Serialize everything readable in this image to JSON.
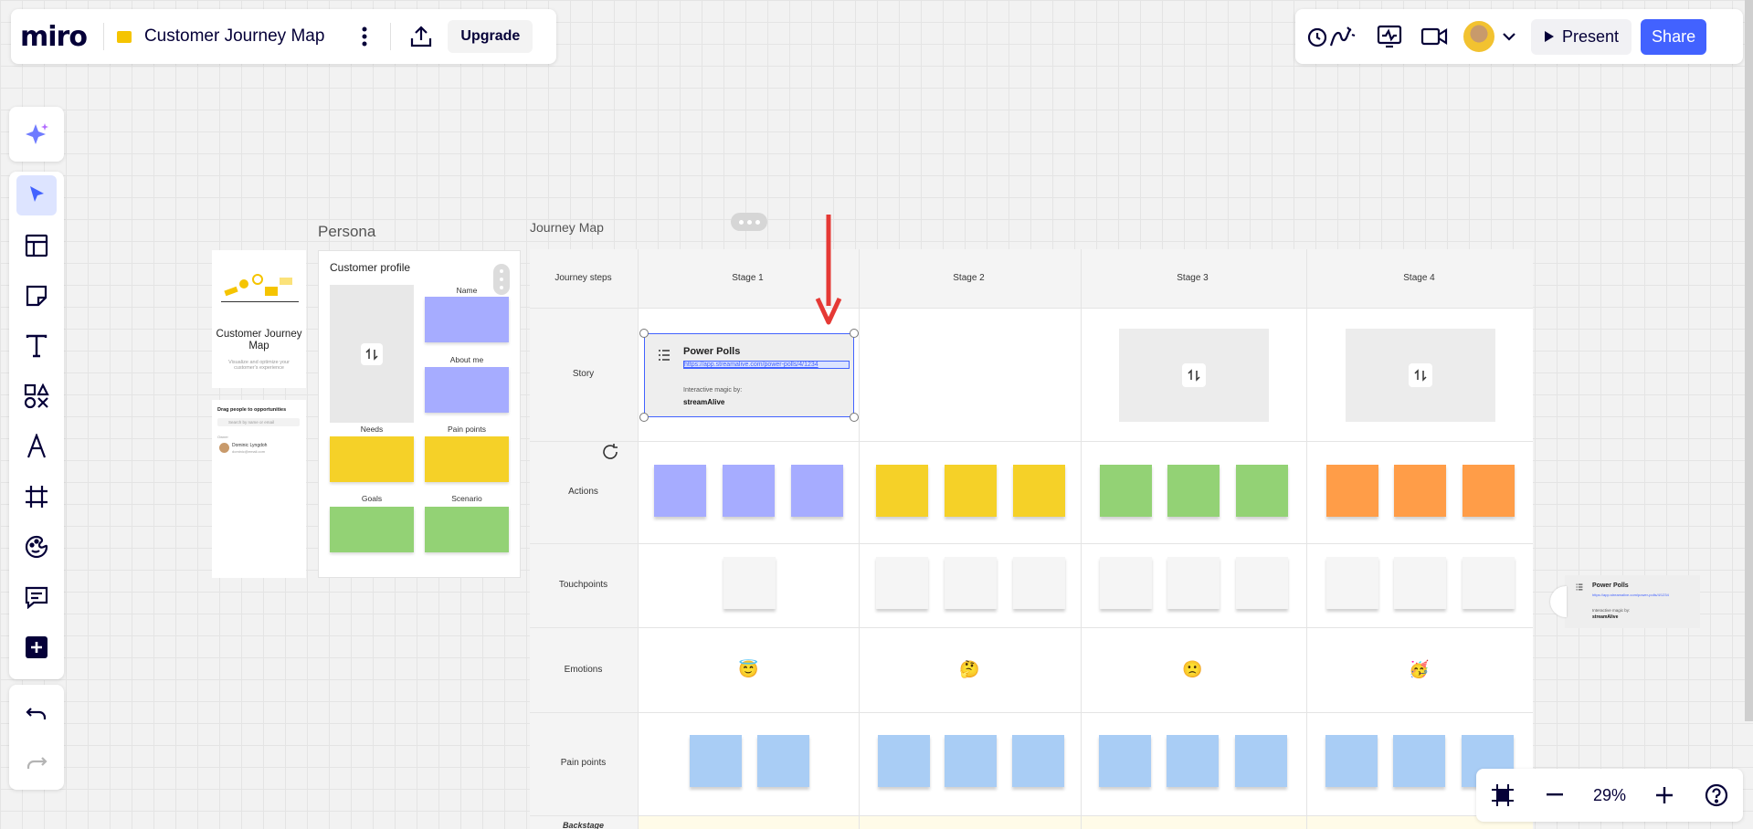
{
  "app": {
    "logo": "miro",
    "board_title": "Customer Journey Map",
    "upgrade_label": "Upgrade"
  },
  "header_right": {
    "present_label": "Present",
    "share_label": "Share"
  },
  "zoom": {
    "level": "29%"
  },
  "persona": {
    "section_title": "Persona",
    "card_title": "Customer Journey Map",
    "card_subtitle": "Visualize and optimize your customer's experience",
    "drag_title": "Drag people to opportunities",
    "search_placeholder": "Search by name or email",
    "owner_label": "Owner",
    "owner_name": "Dominic Lyngdoh",
    "owner_email": "dominic@email.com",
    "profile_title": "Customer profile",
    "labels": {
      "name": "Name",
      "about": "About me",
      "needs": "Needs",
      "pain": "Pain points",
      "goals": "Goals",
      "scenario": "Scenario"
    }
  },
  "journey": {
    "section_title": "Journey Map",
    "steps_header": "Journey steps",
    "stages": [
      "Stage 1",
      "Stage 2",
      "Stage 3",
      "Stage 4"
    ],
    "rows": [
      "Story",
      "Actions",
      "Touchpoints",
      "Emotions",
      "Pain points",
      "Backstage"
    ],
    "emotions": [
      "😇",
      "🤔",
      "🙁",
      "🥳"
    ],
    "colors": {
      "stage1": "#a6acff",
      "stage2": "#f5d128",
      "stage3": "#93d275",
      "stage4": "#ff9d48",
      "pain": "#a9cdf5",
      "touch": "#f5f5f5",
      "arrow": "#e53935",
      "accent": "#4262ff"
    }
  },
  "poll": {
    "title": "Power Polls",
    "url": "https://app.streamalive.com/power-polls/4/1234",
    "magic_label": "Interactive magic by:",
    "brand": "streamAlive"
  }
}
